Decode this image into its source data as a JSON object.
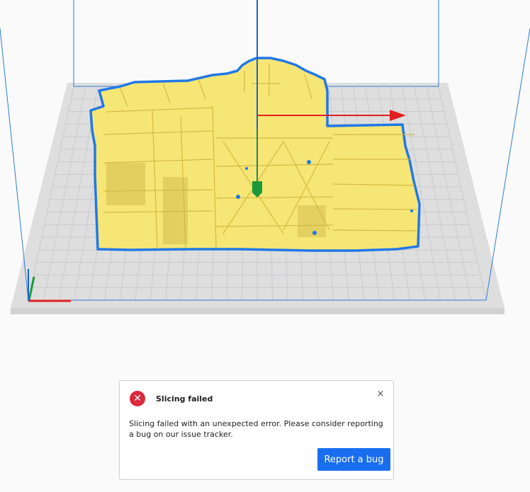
{
  "viewport": {
    "colors": {
      "background": "#fafafa",
      "build_plate": "#dedede",
      "grid": "#c9cacd",
      "build_volume_lines": "#2d7bd8",
      "model": "#f6e675",
      "model_outline": "#2278e6",
      "axis_x": "#e02020",
      "axis_y": "#1a9a3a",
      "axis_z": "#1a64c8"
    }
  },
  "notification": {
    "title": "Slicing failed",
    "message": "Slicing failed with an unexpected error. Please consider reporting a bug on our issue tracker.",
    "close_symbol": "×",
    "error_symbol": "✕",
    "report_button_label": "Report a bug",
    "accent_color": "#196ef0",
    "error_color": "#d9293a"
  }
}
